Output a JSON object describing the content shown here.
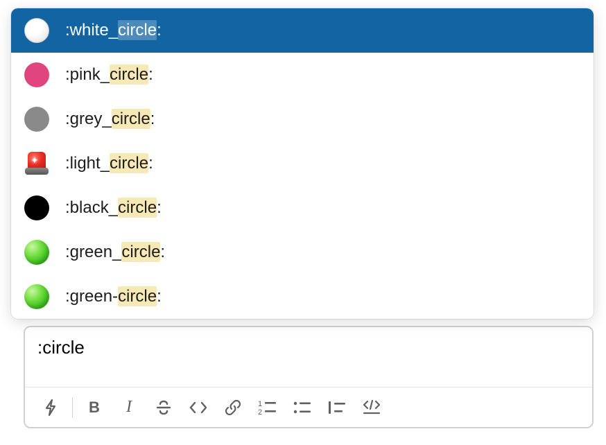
{
  "search_query": "circle",
  "emoji_list": [
    {
      "name": ":white_circle:",
      "prefix": ":white_",
      "match": "circle",
      "suffix": ":",
      "icon": "white-circle",
      "selected": true
    },
    {
      "name": ":pink_circle:",
      "prefix": ":pink_",
      "match": "circle",
      "suffix": ":",
      "icon": "pink-circle",
      "selected": false
    },
    {
      "name": ":grey_circle:",
      "prefix": ":grey_",
      "match": "circle",
      "suffix": ":",
      "icon": "grey-circle",
      "selected": false
    },
    {
      "name": ":light_circle:",
      "prefix": ":light_",
      "match": "circle",
      "suffix": ":",
      "icon": "siren",
      "selected": false
    },
    {
      "name": ":black_circle:",
      "prefix": ":black_",
      "match": "circle",
      "suffix": ":",
      "icon": "black-circle",
      "selected": false
    },
    {
      "name": ":green_circle:",
      "prefix": ":green_",
      "match": "circle",
      "suffix": ":",
      "icon": "green-circle",
      "selected": false
    },
    {
      "name": ":green-circle:",
      "prefix": ":green-",
      "match": "circle",
      "suffix": ":",
      "icon": "green-circle",
      "selected": false
    }
  ],
  "composer": {
    "input_value": ":circle"
  },
  "toolbar": {
    "shortcuts": "shortcuts",
    "bold": "B",
    "italic": "I",
    "strike": "strikethrough",
    "code": "code",
    "link": "link",
    "olist": "ordered-list",
    "ulist": "bulleted-list",
    "quote": "blockquote",
    "codeblock": "code-block"
  }
}
